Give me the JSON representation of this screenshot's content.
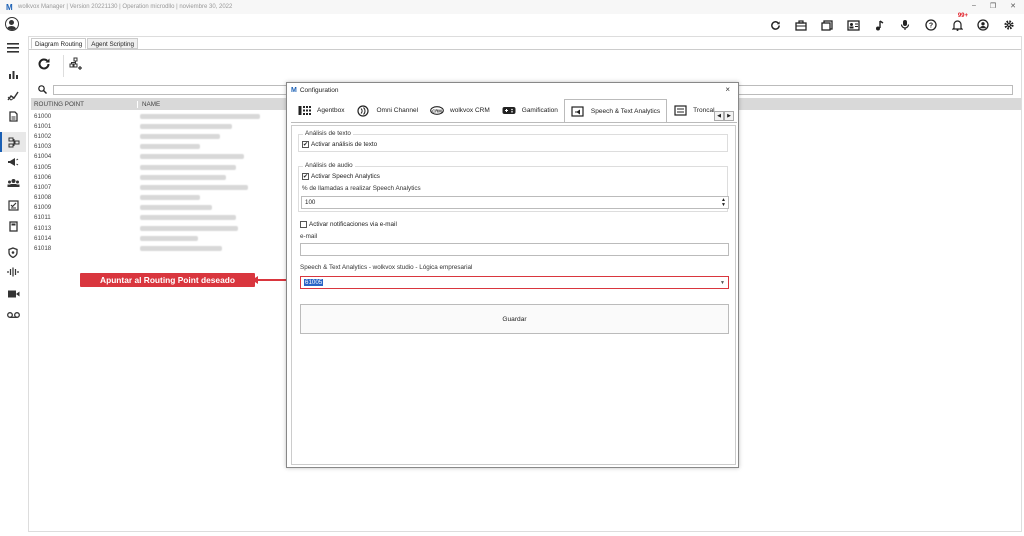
{
  "window": {
    "logo": "M",
    "title": "wolkvox Manager  | Version 20221130 |  Operation microdllo | noviembre 30, 2022",
    "controls": [
      "–",
      "❐",
      "✕"
    ]
  },
  "topbar": {
    "icons": [
      "refresh-icon",
      "briefcase-icon",
      "book-icon",
      "contact-card-icon",
      "music-icon",
      "microphone-icon",
      "help-icon",
      "bell-icon",
      "user-icon",
      "gear-icon"
    ],
    "notification_badge": "99+"
  },
  "sidebar": {
    "items": [
      "menu-icon",
      "bar-chart-icon",
      "trend-icon",
      "document-icon",
      "routing-icon",
      "megaphone-icon",
      "team-icon",
      "checklist-icon",
      "calculator-icon",
      "shield-icon",
      "waveform-icon",
      "video-icon",
      "voicemail-icon"
    ],
    "active_index": 4
  },
  "main": {
    "tabs": [
      {
        "label": "Diagram Routing",
        "active": true
      },
      {
        "label": "Agent Scripting",
        "active": false
      }
    ],
    "grid": {
      "columns": [
        "ROUTING POINT",
        "NAME"
      ],
      "rows": [
        "61000",
        "61001",
        "61002",
        "61003",
        "61004",
        "61005",
        "61006",
        "61007",
        "61008",
        "61009",
        "61011",
        "61013",
        "61014",
        "61018"
      ]
    }
  },
  "modal": {
    "logo": "M",
    "title": "Configuration",
    "close": "×",
    "tabs": [
      {
        "label": "Agentbox",
        "icon": "phone-grid-icon"
      },
      {
        "label": "Omni Channel",
        "icon": "omni-icon"
      },
      {
        "label": "wolkvox CRM",
        "icon": "crm-icon"
      },
      {
        "label": "Gamification",
        "icon": "gamepad-icon"
      },
      {
        "label": "Speech & Text Analytics",
        "icon": "speech-icon",
        "active": true
      },
      {
        "label": "Troncal",
        "icon": "trunk-icon"
      }
    ],
    "text_analysis": {
      "legend": "Análisis de texto",
      "checkbox_label": "Activar análisis de texto",
      "checked": true
    },
    "audio_analysis": {
      "legend": "Análisis de audio",
      "checkbox_label": "Activar Speech Analytics",
      "checked": true,
      "percent_label": "% de llamadas a realizar Speech Analytics",
      "percent_value": "100"
    },
    "notifications": {
      "checkbox_label": "Activar notificaciones via e-mail",
      "checked": false,
      "email_label": "e-mail",
      "email_value": ""
    },
    "studio": {
      "label": "Speech & Text Analytics - wolkvox studio - Lógica empresarial",
      "selected": "61005"
    },
    "save_label": "Guardar"
  },
  "callout": {
    "text": "Apuntar al Routing Point deseado",
    "color": "#d9363e"
  }
}
